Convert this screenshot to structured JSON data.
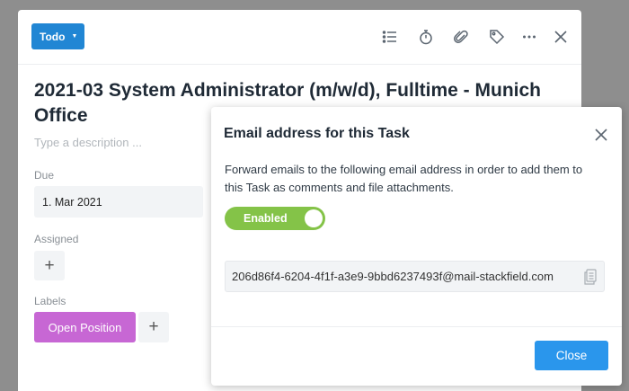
{
  "task": {
    "status_label": "Todo",
    "title": "2021-03 System Administrator (m/w/d), Fulltime - Munich Office",
    "description_placeholder": "Type a description ...",
    "due_label": "Due",
    "due_value": "1. Mar 2021",
    "assigned_label": "Assigned",
    "labels_label": "Labels",
    "label_chip": "Open Position",
    "label_chip_color": "#c767d4",
    "status_color": "#2186d4",
    "toolbar_icons": [
      "list-icon",
      "stopwatch-icon",
      "paperclip-icon",
      "tag-icon",
      "more-icon",
      "close-icon"
    ]
  },
  "dialog": {
    "title": "Email address for this Task",
    "description": "Forward emails to the following email address in order to add them to this Task as comments and file attachments.",
    "toggle_label": "Enabled",
    "toggle_color": "#84c348",
    "email": "206d86f4-6204-4f1f-a3e9-9bbd6237493f@mail-stackfield.com",
    "close_label": "Close",
    "close_color": "#2a96ec"
  }
}
